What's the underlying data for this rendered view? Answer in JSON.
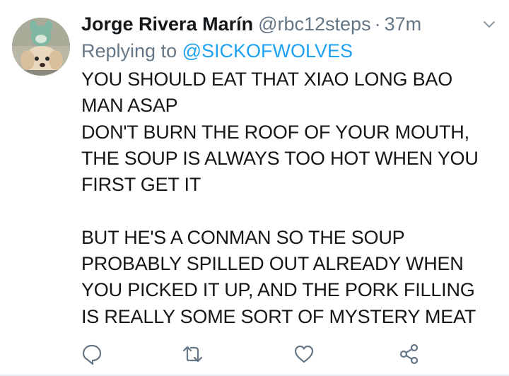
{
  "tweet": {
    "display_name": "Jorge Rivera Marín",
    "handle": "@rbc12steps",
    "separator": "·",
    "time": "37m",
    "replying_prefix": "Replying to ",
    "replying_handle": "@SICKOFWOLVES",
    "lines": [
      "YOU SHOULD EAT THAT XIAO LONG BAO",
      "MAN ASAP",
      "DON'T BURN THE ROOF OF YOUR MOUTH,",
      "THE SOUP IS ALWAYS TOO HOT WHEN YOU",
      "FIRST GET IT",
      "",
      "BUT HE'S A CONMAN SO THE SOUP",
      "PROBABLY SPILLED OUT ALREADY WHEN",
      "YOU PICKED IT UP, AND THE PORK FILLING",
      "IS REALLY SOME SORT OF MYSTERY MEAT"
    ]
  },
  "actions": {
    "icons": [
      "reply-icon",
      "retweet-icon",
      "like-icon",
      "share-icon"
    ]
  },
  "colors": {
    "text": "#14171a",
    "secondary": "#657786",
    "link": "#1da1f2",
    "divider": "#e6ecf0"
  }
}
